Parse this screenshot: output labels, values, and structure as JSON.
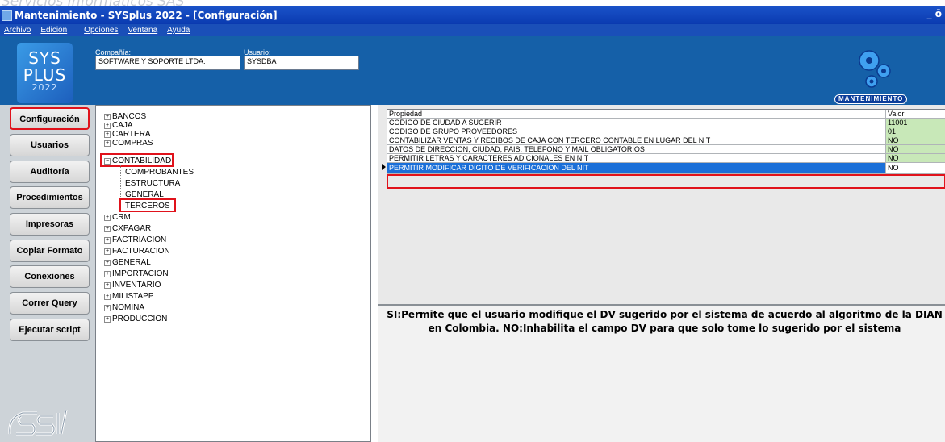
{
  "watermark": "Servicios Informáticos SAS",
  "window": {
    "title": "Mantenimiento - SYSplus 2022 - [Configuración]",
    "controls": "_ ō"
  },
  "menu": [
    "Archivo",
    "Edición",
    "Opciones",
    "Ventana",
    "Ayuda"
  ],
  "header": {
    "logo": {
      "line1": "SYS",
      "line2": "PLUS",
      "year": "2022"
    },
    "company_label": "Compañía:",
    "company_value": "SOFTWARE Y SOPORTE LTDA.",
    "user_label": "Usuario:",
    "user_value": "SYSDBA",
    "badge": "MANTENIMIENTO"
  },
  "sidebar": {
    "buttons": [
      "Configuración",
      "Usuarios",
      "Auditoría",
      "Procedimientos",
      "Impresoras",
      "Copiar Formato",
      "Conexiones",
      "Correr Query",
      "Ejecutar script"
    ],
    "active": "Configuración"
  },
  "tree": {
    "nodes": [
      {
        "label": "BANCOS"
      },
      {
        "label": "CAJA"
      },
      {
        "label": "CARTERA"
      },
      {
        "label": "COMPRAS"
      },
      {
        "label": "CONTABILIDAD",
        "expanded": true
      },
      {
        "label": "CRM"
      },
      {
        "label": "CXPAGAR"
      },
      {
        "label": "FACTRIACION"
      },
      {
        "label": "FACTURACION"
      },
      {
        "label": "GENERAL"
      },
      {
        "label": "IMPORTACION"
      },
      {
        "label": "INVENTARIO"
      },
      {
        "label": "MILISTAPP"
      },
      {
        "label": "NOMINA"
      },
      {
        "label": "PRODUCCION"
      }
    ],
    "children": [
      "COMPROBANTES",
      "ESTRUCTURA",
      "GENERAL",
      "TERCEROS"
    ],
    "selected_child": "TERCEROS"
  },
  "grid": {
    "headers": {
      "property": "Propiedad",
      "value": "Valor"
    },
    "rows": [
      {
        "property": "CODIGO DE CIUDAD A SUGERIR",
        "value": "11001"
      },
      {
        "property": "CODIGO DE GRUPO PROVEEDORES",
        "value": "01"
      },
      {
        "property": "CONTABILIZAR VENTAS Y RECIBOS DE CAJA CON TERCERO CONTABLE EN LUGAR DEL NIT",
        "value": "NO"
      },
      {
        "property": "DATOS DE DIRECCION, CIUDAD, PAIS, TELEFONO Y MAIL OBLIGATORIOS",
        "value": "NO"
      },
      {
        "property": "PERMITIR LETRAS Y CARACTERES ADICIONALES EN NIT",
        "value": "NO"
      },
      {
        "property": "PERMITIR MODIFICAR DIGITO DE VERIFICACION DEL NIT",
        "value": "NO",
        "selected": true
      }
    ]
  },
  "description": {
    "line1": "SI:Permite que el usuario modifique el DV sugerido por el sistema de acuerdo al algoritmo de la DIAN",
    "line2": "en Colombia. NO:Inhabilita el campo DV para que solo tome lo sugerido por el sistema"
  },
  "colors": {
    "header": "#1560a8",
    "titlebar": "#1a52c8",
    "highlight": "#e0121b",
    "selection": "#1a6fd8",
    "value_bg": "#c8e8b8"
  }
}
